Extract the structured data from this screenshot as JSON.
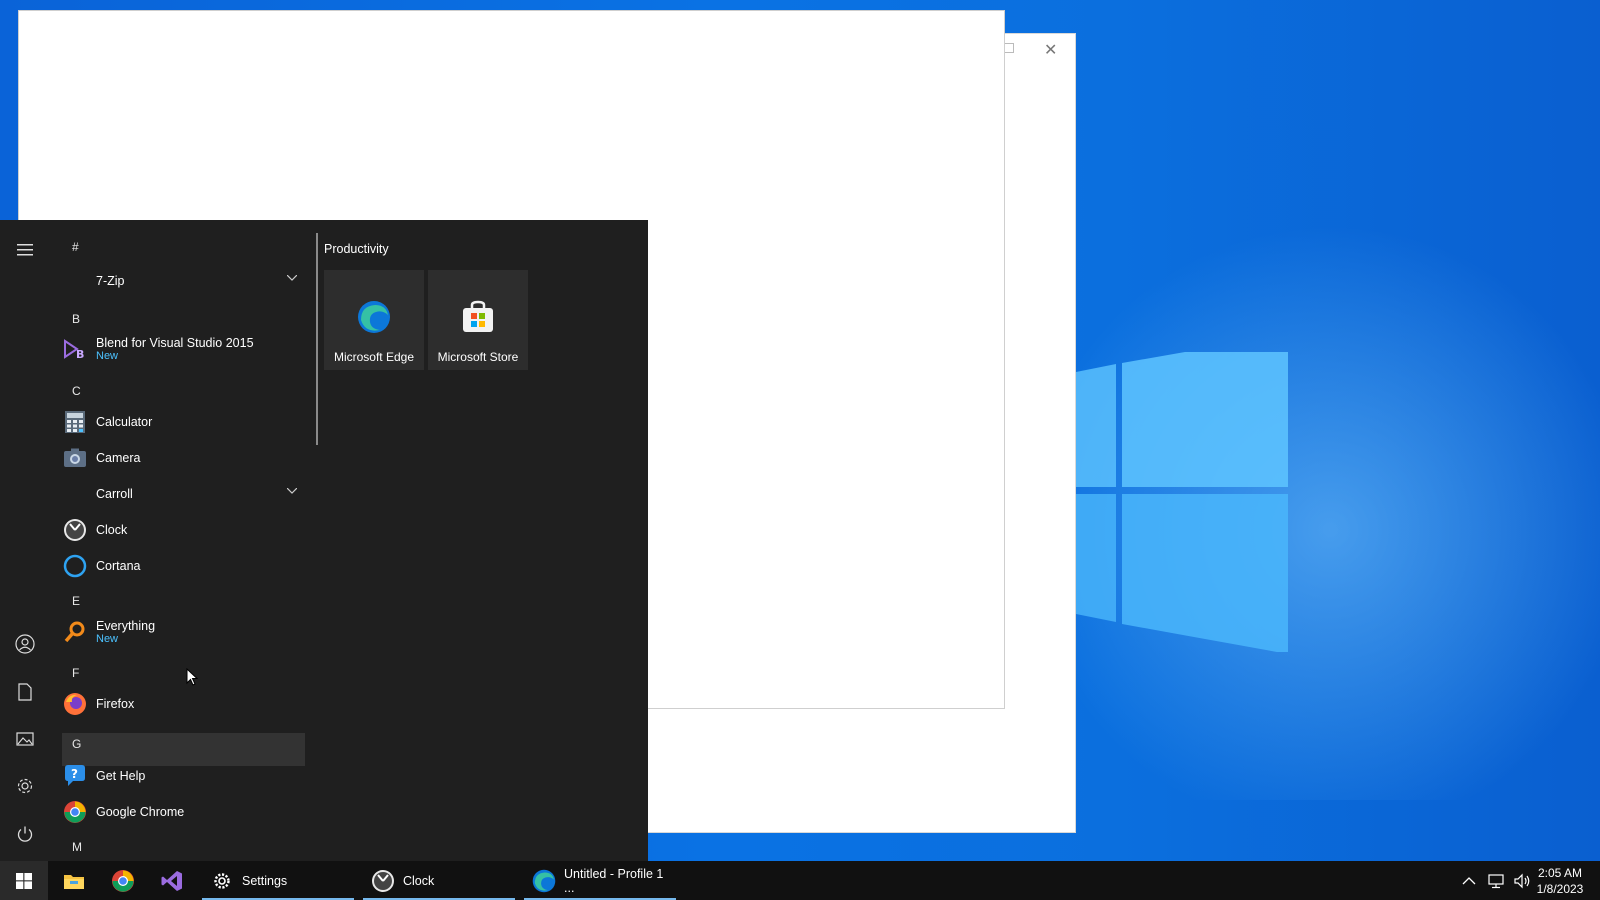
{
  "background_window": {
    "close_glyph": "✕"
  },
  "start_menu": {
    "apps": [
      {
        "letter": "#"
      },
      {
        "name": "7-Zip",
        "icon": "folder-icon",
        "expandable": true
      },
      {
        "letter": "B"
      },
      {
        "name": "Blend for Visual Studio 2015",
        "sub": "New",
        "icon": "blend-icon"
      },
      {
        "letter": "C"
      },
      {
        "name": "Calculator",
        "icon": "calculator-icon"
      },
      {
        "name": "Camera",
        "icon": "camera-icon"
      },
      {
        "name": "Carroll",
        "icon": "folder-icon",
        "expandable": true
      },
      {
        "name": "Clock",
        "icon": "clock-icon"
      },
      {
        "name": "Cortana",
        "icon": "cortana-icon"
      },
      {
        "letter": "E"
      },
      {
        "name": "Everything",
        "sub": "New",
        "icon": "everything-icon"
      },
      {
        "letter": "F"
      },
      {
        "name": "Firefox",
        "icon": "firefox-icon"
      },
      {
        "letter": "G"
      },
      {
        "name": "Get Help",
        "icon": "get-help-icon"
      },
      {
        "name": "Google Chrome",
        "icon": "chrome-icon"
      },
      {
        "letter": "M"
      }
    ],
    "tiles_group": "Productivity",
    "tiles": [
      {
        "label": "Microsoft Edge",
        "icon": "edge-icon"
      },
      {
        "label": "Microsoft Store",
        "icon": "store-icon"
      }
    ],
    "rail_icons": [
      "menu-icon",
      "user-icon",
      "documents-icon",
      "pictures-icon",
      "settings-icon",
      "power-icon"
    ]
  },
  "taskbar": {
    "apps": [
      {
        "label": "Settings",
        "icon": "gear-icon"
      },
      {
        "label": "Clock",
        "icon": "clock-icon"
      },
      {
        "label": "Untitled - Profile 1 ...",
        "icon": "edge-icon"
      }
    ],
    "pinned": [
      "file-explorer-icon",
      "chrome-icon",
      "visual-studio-icon"
    ],
    "time": "2:05 AM",
    "date": "1/8/2023"
  },
  "colors": {
    "accent": "#4cc2ff",
    "taskbar": "#111111",
    "start_bg": "#1f1f1f"
  }
}
